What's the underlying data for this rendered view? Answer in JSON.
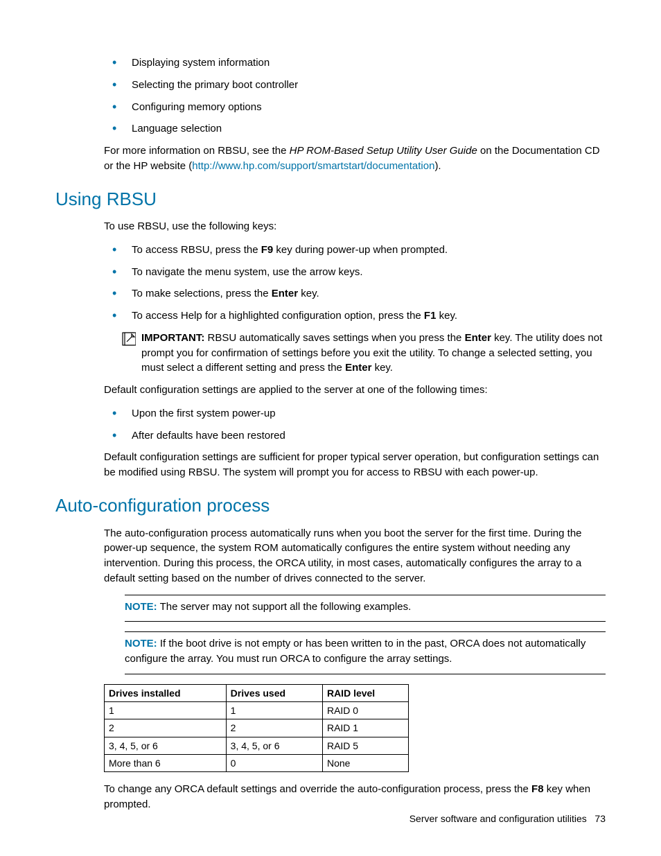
{
  "top_bullets": [
    "Displaying system information",
    "Selecting the primary boot controller",
    "Configuring memory options",
    "Language selection"
  ],
  "intro_para": {
    "prefix": "For more information on RBSU, see the ",
    "italic": "HP ROM-Based Setup Utility User Guide",
    "mid": " on the Documentation CD or the HP website (",
    "link": "http://www.hp.com/support/smartstart/documentation",
    "suffix": ")."
  },
  "sections": {
    "using_rbsu": {
      "heading": "Using RBSU",
      "intro": "To use RBSU, use the following keys:",
      "items": [
        {
          "pre": "To access RBSU, press the ",
          "bold": "F9",
          "post": " key during power-up when prompted."
        },
        {
          "pre": "To navigate the menu system, use the arrow keys.",
          "bold": "",
          "post": ""
        },
        {
          "pre": "To make selections, press the ",
          "bold": "Enter",
          "post": " key."
        },
        {
          "pre": "To access Help for a highlighted configuration option, press the ",
          "bold": "F1",
          "post": " key."
        }
      ],
      "important": {
        "label": "IMPORTANT:",
        "t1": "  RBSU automatically saves settings when you press the ",
        "b1": "Enter",
        "t2": " key. The utility does not prompt you for confirmation of settings before you exit the utility. To change a selected setting, you must select a different setting and press the ",
        "b2": "Enter",
        "t3": " key."
      },
      "default_intro": "Default configuration settings are applied to the server at one of the following times:",
      "default_items": [
        "Upon the first system power-up",
        "After defaults have been restored"
      ],
      "default_para": "Default configuration settings are sufficient for proper typical server operation, but configuration settings can be modified using RBSU. The system will prompt you for access to RBSU with each power-up."
    },
    "auto_config": {
      "heading": "Auto-configuration process",
      "para1": "The auto-configuration process automatically runs when you boot the server for the first time. During the power-up sequence, the system ROM automatically configures the entire system without needing any intervention. During this process, the ORCA utility, in most cases, automatically configures the array to a default setting based on the number of drives connected to the server.",
      "note1": {
        "label": "NOTE:",
        "text": "  The server may not support all the following examples."
      },
      "note2": {
        "label": "NOTE:",
        "text": "  If the boot drive is not empty or has been written to in the past, ORCA does not automatically configure the array. You must run ORCA to configure the array settings."
      },
      "table": {
        "headers": [
          "Drives installed",
          "Drives used",
          "RAID level"
        ],
        "rows": [
          [
            "1",
            "1",
            "RAID 0"
          ],
          [
            "2",
            "2",
            "RAID 1"
          ],
          [
            "3, 4, 5, or 6",
            "3, 4, 5, or 6",
            "RAID 5"
          ],
          [
            "More than 6",
            "0",
            "None"
          ]
        ]
      },
      "para2": {
        "pre": "To change any ORCA default settings and override the auto-configuration process, press the ",
        "bold": "F8",
        "post": " key when prompted."
      }
    }
  },
  "footer": {
    "section": "Server software and configuration utilities",
    "page": "73"
  }
}
